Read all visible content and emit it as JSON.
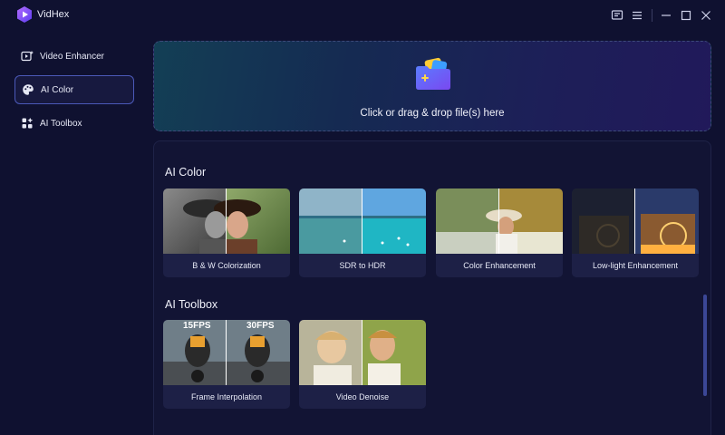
{
  "app": {
    "name": "VidHex"
  },
  "sidebar": {
    "items": [
      {
        "label": "Video Enhancer",
        "icon": "video-enhancer-icon",
        "active": false
      },
      {
        "label": "AI Color",
        "icon": "palette-icon",
        "active": true
      },
      {
        "label": "AI Toolbox",
        "icon": "toolbox-icon",
        "active": false
      }
    ]
  },
  "dropzone": {
    "text": "Click or drag & drop file(s) here",
    "icon": "folder-plus-icon"
  },
  "sections": {
    "ai_color": {
      "title": "AI Color",
      "cards": [
        {
          "label": "B & W Colorization"
        },
        {
          "label": "SDR to HDR"
        },
        {
          "label": "Color Enhancement"
        },
        {
          "label": "Low-light Enhancement"
        }
      ]
    },
    "ai_toolbox": {
      "title": "AI Toolbox",
      "cards": [
        {
          "label": "Frame Interpolation",
          "left_badge": "15FPS",
          "right_badge": "30FPS"
        },
        {
          "label": "Video Denoise"
        }
      ]
    }
  },
  "colors": {
    "background": "#0f1130",
    "accent": "#4b59b8",
    "card": "#1d2046"
  }
}
